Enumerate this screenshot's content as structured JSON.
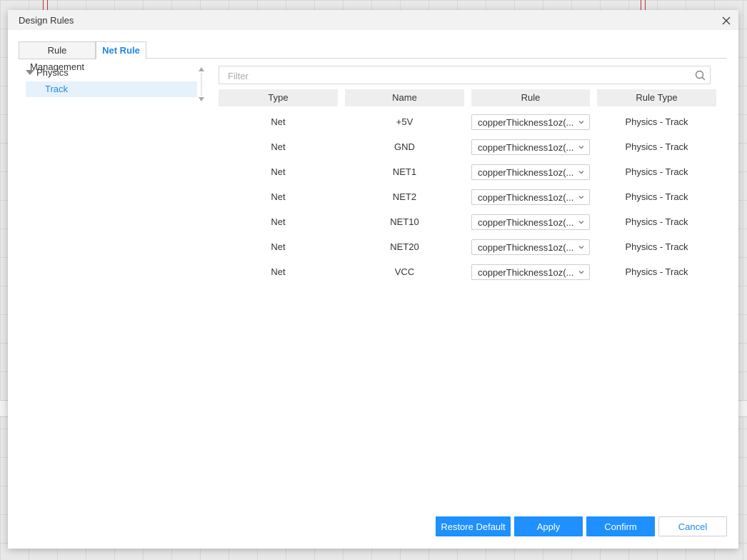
{
  "dialog": {
    "title": "Design Rules"
  },
  "tabs": [
    {
      "label": "Rule Management",
      "active": false
    },
    {
      "label": "Net Rule",
      "active": true
    }
  ],
  "tree": {
    "parent": "Physics",
    "child": "Track"
  },
  "filter": {
    "placeholder": "Filter",
    "value": ""
  },
  "table": {
    "headers": [
      "Type",
      "Name",
      "Rule",
      "Rule Type"
    ],
    "rows": [
      {
        "type": "Net",
        "name": "+5V",
        "rule": "copperThickness1oz(...",
        "rule_type": "Physics - Track"
      },
      {
        "type": "Net",
        "name": "GND",
        "rule": "copperThickness1oz(...",
        "rule_type": "Physics - Track"
      },
      {
        "type": "Net",
        "name": "NET1",
        "rule": "copperThickness1oz(...",
        "rule_type": "Physics - Track"
      },
      {
        "type": "Net",
        "name": "NET2",
        "rule": "copperThickness1oz(...",
        "rule_type": "Physics - Track"
      },
      {
        "type": "Net",
        "name": "NET10",
        "rule": "copperThickness1oz(...",
        "rule_type": "Physics - Track"
      },
      {
        "type": "Net",
        "name": "NET20",
        "rule": "copperThickness1oz(...",
        "rule_type": "Physics - Track"
      },
      {
        "type": "Net",
        "name": "VCC",
        "rule": "copperThickness1oz(...",
        "rule_type": "Physics - Track"
      }
    ]
  },
  "buttons": {
    "restore": "Restore Default",
    "apply": "Apply",
    "confirm": "Confirm",
    "cancel": "Cancel"
  },
  "colors": {
    "accent": "#1e90ff",
    "selected_bg": "#e6f2fb",
    "header_bg": "#eeeeee"
  }
}
